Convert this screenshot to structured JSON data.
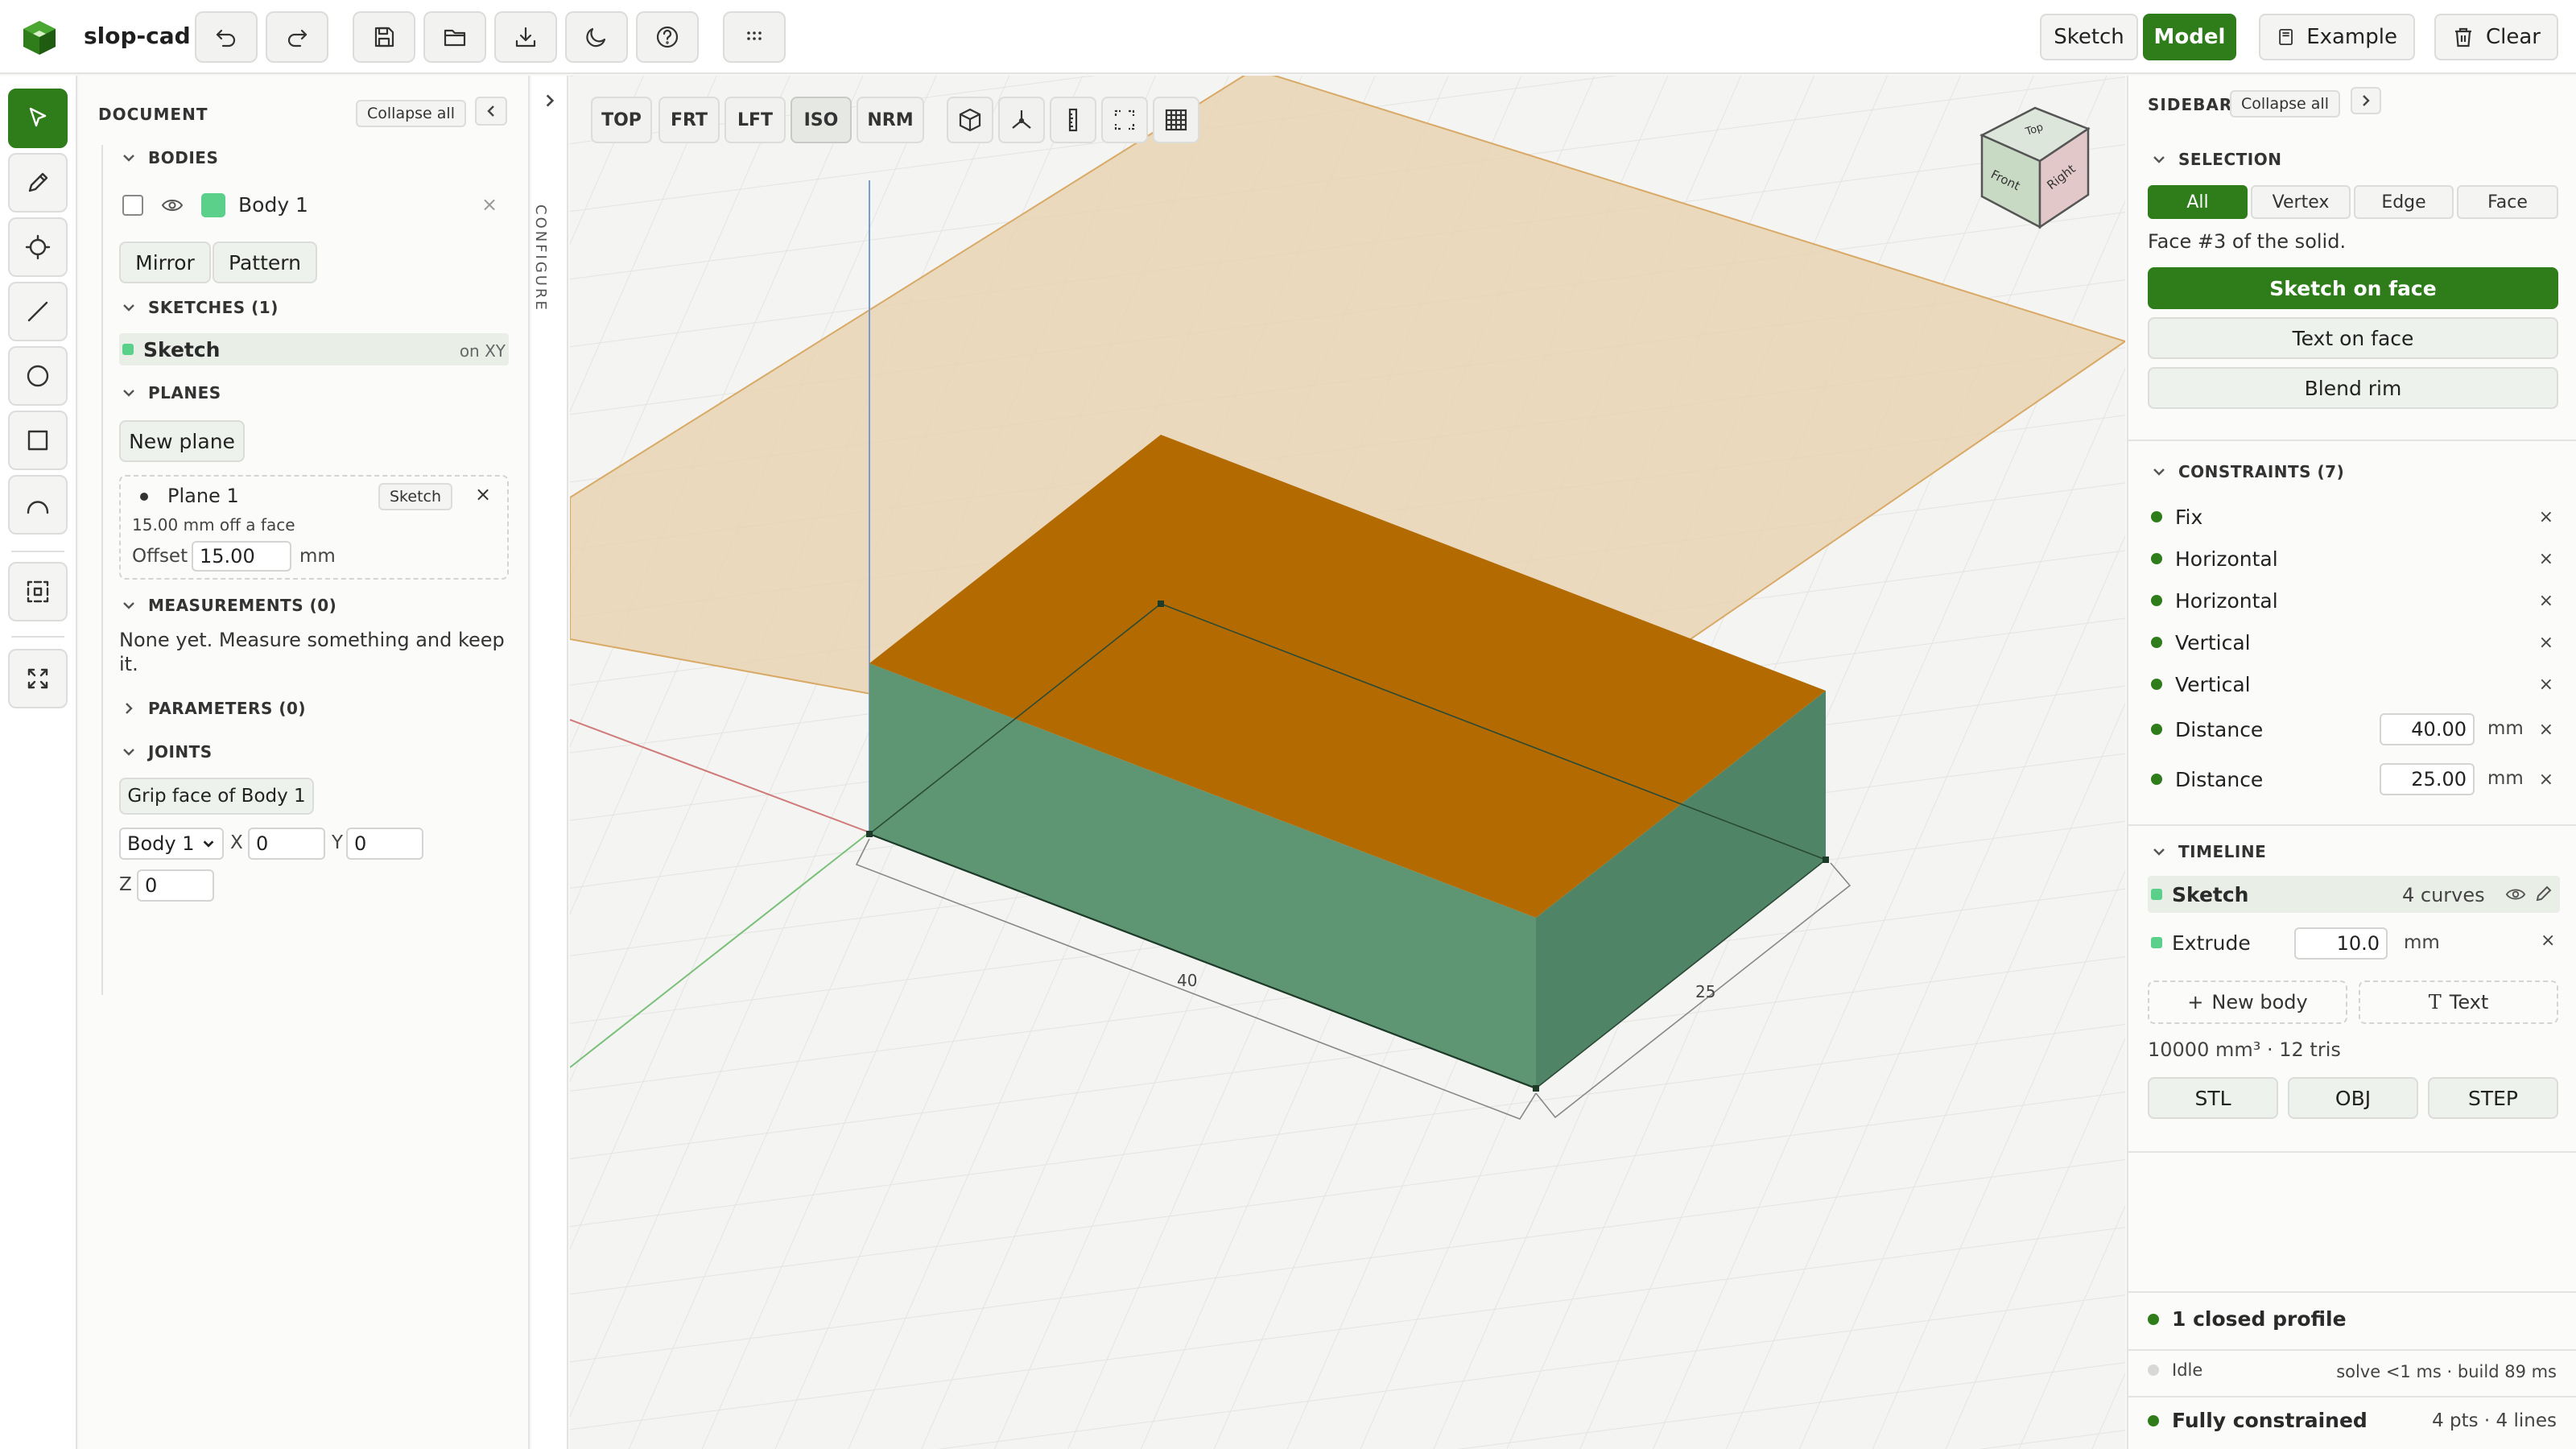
{
  "app": {
    "name": "slop-cad"
  },
  "header": {
    "modes": [
      {
        "label": "Sketch",
        "active": false
      },
      {
        "label": "Model",
        "active": true
      }
    ],
    "example_label": "Example",
    "clear_label": "Clear"
  },
  "document": {
    "title": "DOCUMENT",
    "collapse_label": "Collapse all",
    "bodies": {
      "title": "BODIES",
      "items": [
        {
          "name": "Body 1",
          "color": "#5ad08a"
        }
      ],
      "mirror_label": "Mirror",
      "pattern_label": "Pattern"
    },
    "sketches": {
      "title": "SKETCHES (1)",
      "items": [
        {
          "name": "Sketch",
          "plane": "on XY"
        }
      ]
    },
    "planes": {
      "title": "PLANES",
      "new_label": "New plane",
      "items": [
        {
          "name": "Plane 1",
          "sketch_label": "Sketch",
          "desc": "15.00 mm off a face",
          "offset_label": "Offset",
          "offset_value": "15.00",
          "unit": "mm"
        }
      ]
    },
    "measurements": {
      "title": "MEASUREMENTS (0)",
      "empty": "None yet. Measure something and keep it."
    },
    "parameters": {
      "title": "PARAMETERS (0)"
    },
    "joints": {
      "title": "JOINTS",
      "grip_label": "Grip face of Body 1",
      "body_select": "Body 1",
      "x_label": "X",
      "x_value": "0",
      "y_label": "Y",
      "y_value": "0",
      "z_label": "Z",
      "z_value": "0"
    }
  },
  "configure": {
    "label": "CONFIGURE"
  },
  "viewport": {
    "views": [
      {
        "label": "TOP",
        "active": false
      },
      {
        "label": "FRT",
        "active": false
      },
      {
        "label": "LFT",
        "active": false
      },
      {
        "label": "ISO",
        "active": true
      },
      {
        "label": "NRM",
        "active": false
      }
    ],
    "cube": {
      "top": "Top",
      "front": "Front",
      "right": "Right"
    },
    "dims": {
      "length": "40",
      "width": "25"
    },
    "colors": {
      "top_face": "#b36a00",
      "side_face": "#5e9673",
      "plane": "#e8d2b0"
    }
  },
  "sidebar": {
    "title": "SIDEBAR",
    "collapse_label": "Collapse all",
    "selection": {
      "title": "SELECTION",
      "filters": [
        {
          "label": "All",
          "active": true
        },
        {
          "label": "Vertex",
          "active": false
        },
        {
          "label": "Edge",
          "active": false
        },
        {
          "label": "Face",
          "active": false
        }
      ],
      "info": "Face #3 of the solid.",
      "sketch_on_face": "Sketch on face",
      "text_on_face": "Text on face",
      "blend_rim": "Blend rim"
    },
    "constraints": {
      "title": "CONSTRAINTS (7)",
      "items": [
        {
          "label": "Fix"
        },
        {
          "label": "Horizontal"
        },
        {
          "label": "Horizontal"
        },
        {
          "label": "Vertical"
        },
        {
          "label": "Vertical"
        },
        {
          "label": "Distance",
          "value": "40.00",
          "unit": "mm"
        },
        {
          "label": "Distance",
          "value": "25.00",
          "unit": "mm"
        }
      ]
    },
    "timeline": {
      "title": "TIMELINE",
      "sketch": {
        "label": "Sketch",
        "info": "4 curves"
      },
      "extrude": {
        "label": "Extrude",
        "value": "10.0",
        "unit": "mm"
      },
      "new_body": "New body",
      "text": "Text",
      "stats": "10000 mm³ · 12 tris",
      "exports": [
        "STL",
        "OBJ",
        "STEP"
      ]
    },
    "status": {
      "profile": "1 closed profile",
      "state": "Idle",
      "timing": "solve <1 ms · build 89 ms",
      "constrained": "Fully constrained",
      "counts": "4 pts · 4 lines"
    }
  }
}
